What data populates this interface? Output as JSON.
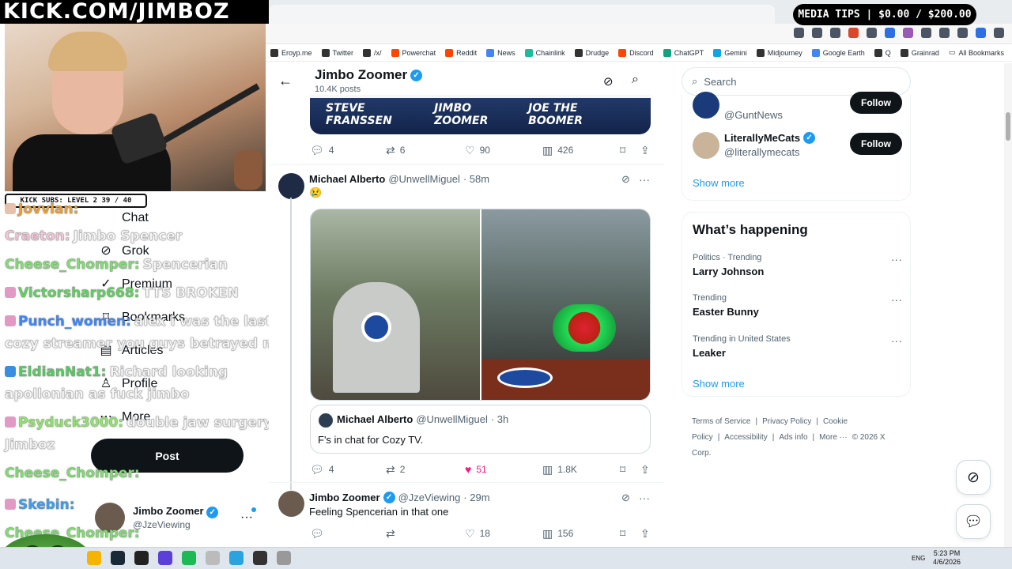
{
  "overlay": {
    "site_title": "KICK.COM/JIMBOZ",
    "subs_bar": "KICK SUBS: LEVEL 2 39 / 40",
    "media_tips": "MEDIA TIPS | $0.00 / $200.00",
    "chat": [
      {
        "user": "Jovvian:",
        "msg": "",
        "color": "#f0a030"
      },
      {
        "user": "Craeton:",
        "msg": "Jimbo Spencer",
        "color": "#f7c6d9"
      },
      {
        "user": "Cheese_Chomper:",
        "msg": "Spencerian",
        "color": "#7ee06f"
      },
      {
        "user": "Victorsharp668:",
        "msg": "TTS BROKEN",
        "color": "#5fd35f"
      },
      {
        "user": "Punch_women:",
        "msg": "alex i was the last",
        "color": "#3a86ff"
      },
      {
        "user": "",
        "msg": "cozy streamer you guys betrayed me",
        "color": "#ffffff"
      },
      {
        "user": "EldianNat1:",
        "msg": "Richard looking",
        "color": "#4fd05a"
      },
      {
        "user": "",
        "msg": "apollonian as fuck jimbo",
        "color": "#ffffff"
      },
      {
        "user": "Psyduck3000:",
        "msg": "double jaw surgery",
        "color": "#8ee86a"
      },
      {
        "user": "",
        "msg": "Jimboz",
        "color": "#ffffff"
      },
      {
        "user": "Cheese_Chomper:",
        "msg": "",
        "color": "#7ee06f"
      },
      {
        "user": "Skebin:",
        "msg": "",
        "color": "#3a9ff0"
      },
      {
        "user": "Cheese_Chomper:",
        "msg": "",
        "color": "#7ee06f"
      }
    ]
  },
  "browser": {
    "bookmarks": [
      {
        "label": "Eroyp.me",
        "icon": "site-icon"
      },
      {
        "label": "Twitter",
        "icon": "x-icon"
      },
      {
        "label": "/x/",
        "icon": "grid-icon"
      },
      {
        "label": "Powerchat",
        "icon": "p-icon"
      },
      {
        "label": "Reddit",
        "icon": "reddit-icon"
      },
      {
        "label": "News",
        "icon": "news-icon"
      },
      {
        "label": "Chainlink",
        "icon": "link-icon"
      },
      {
        "label": "Drudge",
        "icon": "drudge-icon"
      },
      {
        "label": "Discord",
        "icon": "discord-icon"
      },
      {
        "label": "ChatGPT",
        "icon": "chatgpt-icon"
      },
      {
        "label": "Gemini",
        "icon": "gemini-icon"
      },
      {
        "label": "Midjourney",
        "icon": "midjourney-icon"
      },
      {
        "label": "Google Earth",
        "icon": "earth-icon"
      },
      {
        "label": "Q",
        "icon": "q-icon"
      },
      {
        "label": "Grainrad",
        "icon": "grainrad-icon"
      }
    ],
    "all_bookmarks": "All Bookmarks"
  },
  "xnav": {
    "items": [
      {
        "label": "Chat",
        "icon": "chat-icon"
      },
      {
        "label": "Grok",
        "icon": "grok-icon"
      },
      {
        "label": "Premium",
        "icon": "premium-icon"
      },
      {
        "label": "Bookmarks",
        "icon": "bookmark-icon"
      },
      {
        "label": "Articles",
        "icon": "articles-icon"
      },
      {
        "label": "Profile",
        "icon": "profile-icon"
      },
      {
        "label": "More",
        "icon": "more-icon"
      }
    ],
    "post_label": "Post",
    "account": {
      "name": "Jimbo Zoomer",
      "handle": "@JzeViewing"
    }
  },
  "profile_header": {
    "name": "Jimbo Zoomer",
    "posts": "10.4K posts"
  },
  "banner": {
    "names": [
      "STEVE FRANSSEN",
      "JIMBO ZOOMER",
      "JOE THE BOOMER"
    ]
  },
  "tweet0": {
    "replies": "4",
    "reposts": "6",
    "likes": "90",
    "views": "426"
  },
  "tweet1": {
    "name": "Michael Alberto",
    "handle": "@UnwellMiguel",
    "time": "· 58m",
    "text": "😢",
    "quote": {
      "name": "Michael Alberto",
      "handle": "@UnwellMiguel",
      "time": "· 3h",
      "text": "F's in chat for Cozy TV."
    },
    "replies": "4",
    "reposts": "2",
    "likes": "51",
    "views": "1.8K"
  },
  "tweet2": {
    "name": "Jimbo Zoomer",
    "handle": "@JzeViewing",
    "time": "· 29m",
    "text": "Feeling Spencerian in that one",
    "replies": "",
    "reposts": "",
    "likes": "18",
    "views": "156"
  },
  "right": {
    "search_placeholder": "Search",
    "who_to_follow": [
      {
        "name": "",
        "handle": "@GuntNews",
        "follow": "Follow"
      },
      {
        "name": "LiterallyMeCats",
        "handle": "@literallymecats",
        "follow": "Follow"
      }
    ],
    "show_more": "Show more",
    "trends_title": "What’s happening",
    "trends": [
      {
        "meta": "Politics · Trending",
        "name": "Larry Johnson"
      },
      {
        "meta": "Trending",
        "name": "Easter Bunny"
      },
      {
        "meta": "Trending in United States",
        "name": "Leaker"
      }
    ],
    "show_more_trends": "Show more",
    "footer": [
      "Terms of Service",
      "|",
      "Privacy Policy",
      "|",
      "Cookie Policy",
      "|",
      "Accessibility",
      "|",
      "Ads info",
      "|",
      "More ···",
      "© 2026 X Corp."
    ]
  },
  "taskbar": {
    "lang": "ENG",
    "time": "5:23 PM",
    "date": "4/6/2026"
  },
  "colors": {
    "x_blue": "#1d9bf0",
    "like_pink": "#f91880",
    "dark": "#0f1419",
    "muted": "#536471"
  }
}
